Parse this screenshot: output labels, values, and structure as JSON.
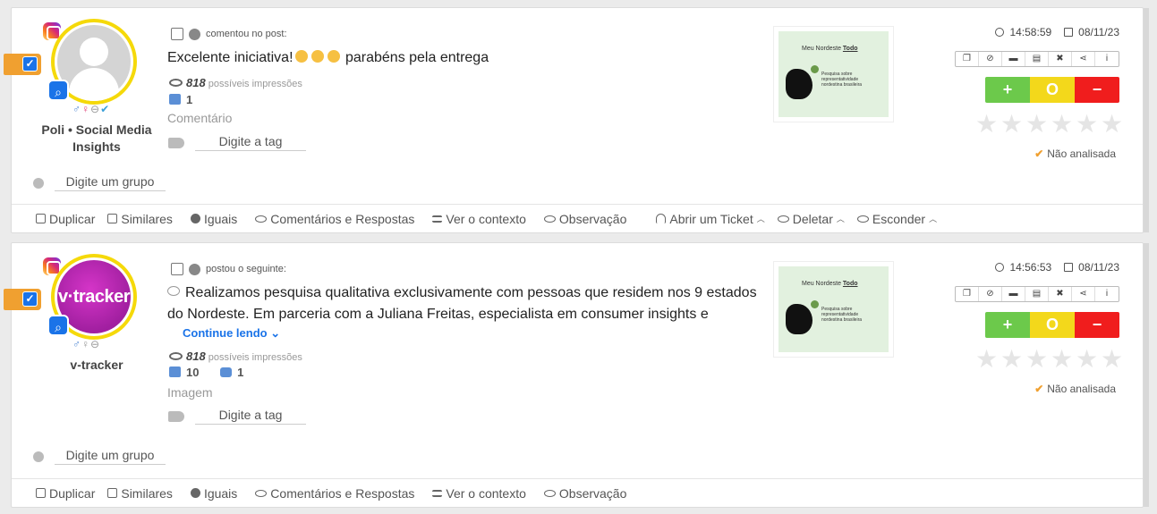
{
  "posts": [
    {
      "network": "instagram",
      "avatar_text": "",
      "author": "Poli • Social Media Insights",
      "action": "comentou no post:",
      "text": "Excelente iniciativa!",
      "text_tail": "parabéns pela entrega",
      "continue_label": "",
      "impressions": "818",
      "impressions_label": "possíveis impressões",
      "likes": "1",
      "comments": "",
      "kind": "Comentário",
      "tag_placeholder": "Digite a tag",
      "group_placeholder": "Digite um grupo",
      "time": "14:58:59",
      "date": "08/11/23",
      "status": "Não analisada",
      "thumbnail": {
        "title_prefix": "Meu Nordeste",
        "title_bold": "Todo",
        "text": "Pesquisa sobre representatividade nordestina brasileira"
      }
    },
    {
      "network": "instagram",
      "avatar_text": "v·tracker",
      "author": "v-tracker",
      "action": "postou o seguinte:",
      "text": "Realizamos pesquisa qualitativa exclusivamente com pessoas que residem nos 9 estados do Nordeste. Em parceria com a Juliana Freitas, especialista em consumer insights e",
      "text_tail": "",
      "continue_label": "Continue lendo",
      "impressions": "818",
      "impressions_label": "possíveis impressões",
      "likes": "10",
      "comments": "1",
      "kind": "Imagem",
      "tag_placeholder": "Digite a tag",
      "group_placeholder": "Digite um grupo",
      "time": "14:56:53",
      "date": "08/11/23",
      "status": "Não analisada",
      "thumbnail": {
        "title_prefix": "Meu Nordeste",
        "title_bold": "Todo",
        "text": "Pesquisa sobre representatividade nordestina brasileira"
      }
    }
  ],
  "sentiment": {
    "positive": "+",
    "neutral": "O",
    "negative": "−"
  },
  "actions_full": [
    "Duplicar",
    "Similares",
    "Iguais",
    "Comentários e Respostas",
    "Ver o contexto",
    "Observação",
    "Abrir um Ticket",
    "Deletar",
    "Esconder"
  ],
  "actions_short": [
    "Duplicar",
    "Similares",
    "Iguais",
    "Comentários e Respostas",
    "Ver o contexto",
    "Observação"
  ],
  "colors": {
    "accent": "#1a73e8",
    "positive": "#6cc94b",
    "neutral": "#f3d81b",
    "negative": "#f01d1d",
    "select_tab": "#f0a030"
  }
}
